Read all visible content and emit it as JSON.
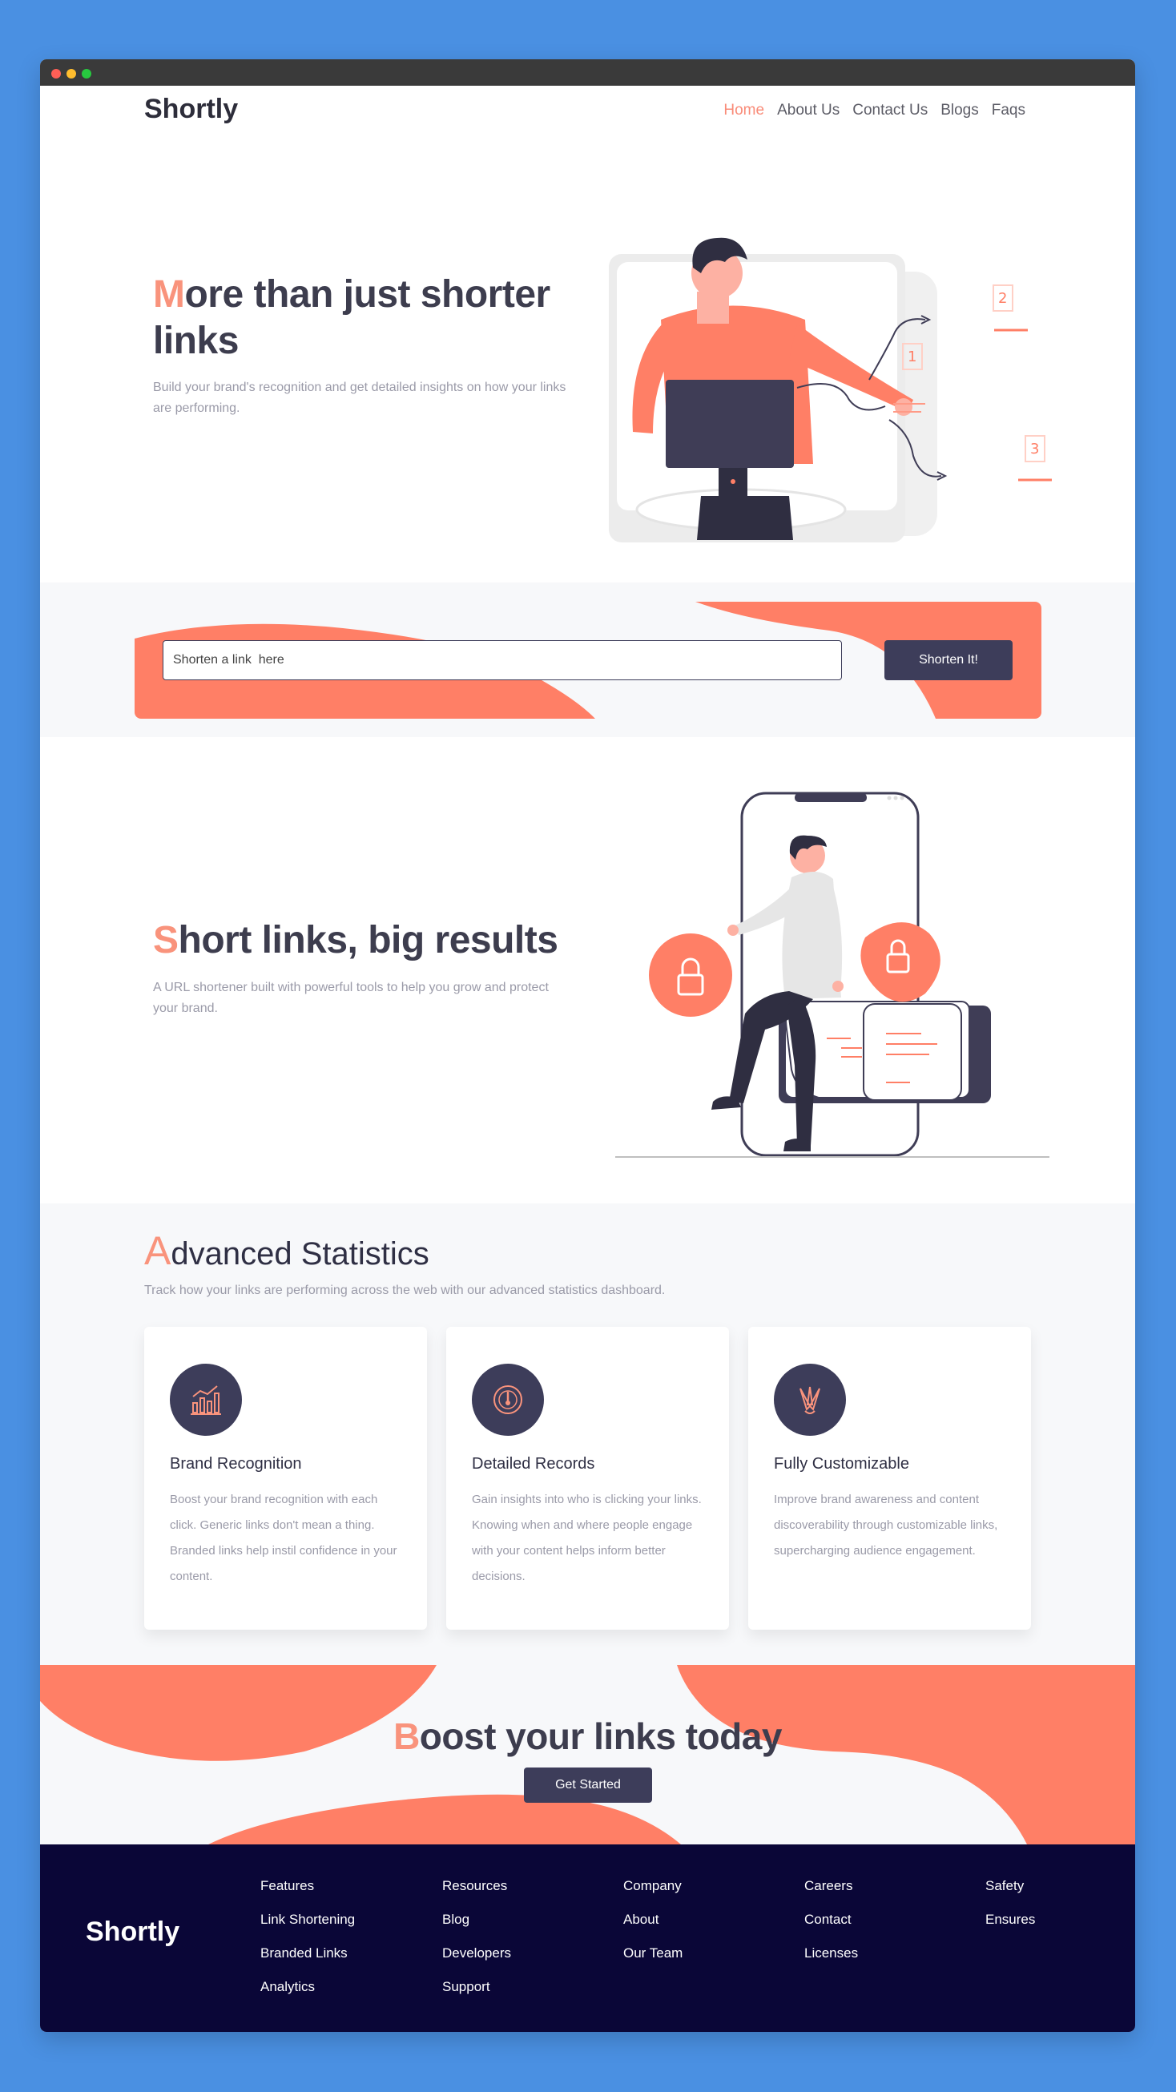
{
  "brand": "Shortly",
  "colors": {
    "accent": "#f9937c",
    "coral": "#ff7f66",
    "navy": "#3d3d5a",
    "footer_bg": "#0a0637",
    "page_bg": "#4a90e2"
  },
  "nav": {
    "items": [
      {
        "label": "Home",
        "active": true
      },
      {
        "label": "About Us"
      },
      {
        "label": "Contact Us"
      },
      {
        "label": "Blogs"
      },
      {
        "label": "Faqs"
      }
    ]
  },
  "hero": {
    "title_first": "M",
    "title_rest_1": "ore than just shorter",
    "title_rest_2": "links",
    "subtitle": "Build your brand's recognition and get detailed insights on how your links are performing."
  },
  "shorten": {
    "placeholder": "Shorten a link  here",
    "button": "Shorten It!"
  },
  "results": {
    "title_first": "S",
    "title_rest": "hort links, big results",
    "subtitle": "A URL shortener built with powerful tools to help you grow and protect your brand."
  },
  "stats": {
    "title_first": "A",
    "title_rest": "dvanced Statistics",
    "lead": "Track how your links are performing across the web with our advanced statistics dashboard.",
    "cards": [
      {
        "icon": "bar-chart-icon",
        "title": "Brand Recognition",
        "text": "Boost your brand recognition with each click. Generic links don't mean a thing. Branded links help instil confidence in your content."
      },
      {
        "icon": "gauge-icon",
        "title": "Detailed Records",
        "text": "Gain insights into who is clicking your links. Knowing when and where people engage with your content helps inform better decisions."
      },
      {
        "icon": "brushes-icon",
        "title": "Fully Customizable",
        "text": "Improve brand awareness and content discoverability through customizable links, supercharging audience engagement."
      }
    ]
  },
  "boost": {
    "title_first": "B",
    "title_rest": "oost your links today",
    "button": "Get Started"
  },
  "footer": {
    "logo": "Shortly",
    "columns": [
      [
        "Features",
        "Link Shortening",
        "Branded Links",
        "Analytics"
      ],
      [
        "Resources",
        "Blog",
        "Developers",
        "Support"
      ],
      [
        "Company",
        "About",
        "Our Team"
      ],
      [
        "Careers",
        "Contact",
        "Licenses"
      ],
      [
        "Safety",
        "Ensures"
      ]
    ]
  }
}
